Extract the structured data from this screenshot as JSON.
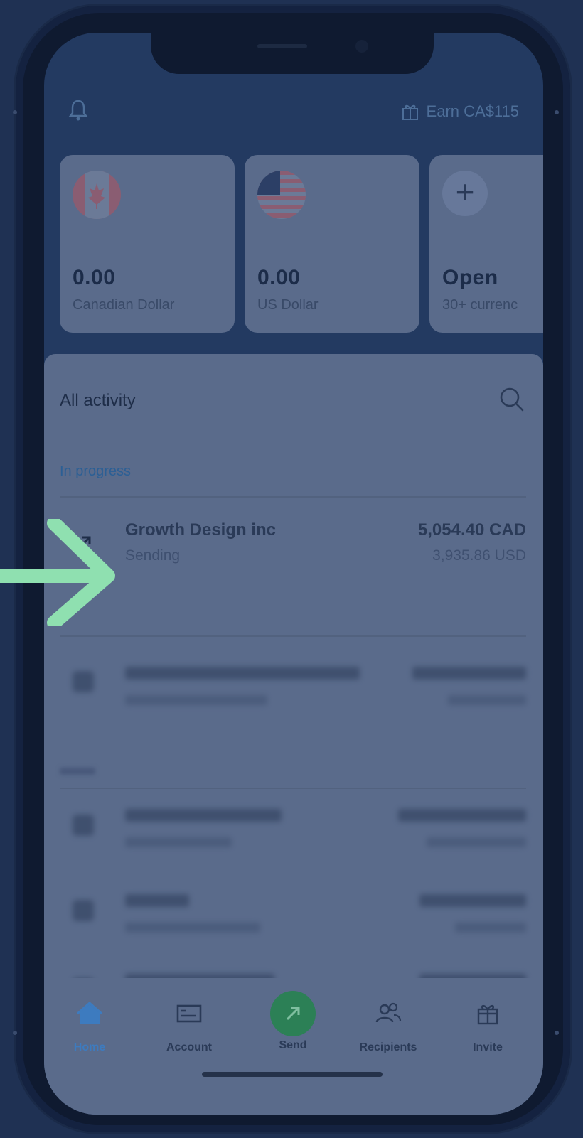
{
  "header": {
    "earn_label": "Earn CA$115"
  },
  "balances": [
    {
      "amount": "0.00",
      "currency": "Canadian Dollar",
      "flag": "canada-flag"
    },
    {
      "amount": "0.00",
      "currency": "US Dollar",
      "flag": "usa-flag"
    },
    {
      "amount": "Open",
      "currency": "30+ currenc",
      "icon": "plus-icon"
    }
  ],
  "activity": {
    "title": "All activity",
    "in_progress_label": "In progress",
    "in_progress": [
      {
        "name": "Growth Design inc",
        "status": "Sending",
        "amount": "5,054.40 CAD",
        "amount_converted": "3,935.86 USD",
        "icon": "send-arrow-icon"
      }
    ]
  },
  "nav": {
    "items": [
      {
        "label": "Home",
        "icon": "home-icon"
      },
      {
        "label": "Account",
        "icon": "account-icon"
      },
      {
        "label": "Send",
        "icon": "send-icon"
      },
      {
        "label": "Recipients",
        "icon": "recipients-icon"
      },
      {
        "label": "Invite",
        "icon": "gift-icon"
      }
    ]
  },
  "colors": {
    "overlay_bg": "#1f3153",
    "accent_arrow": "#8fe0b0",
    "send_button": "#2c8056",
    "home_active": "#3d7bbf"
  }
}
